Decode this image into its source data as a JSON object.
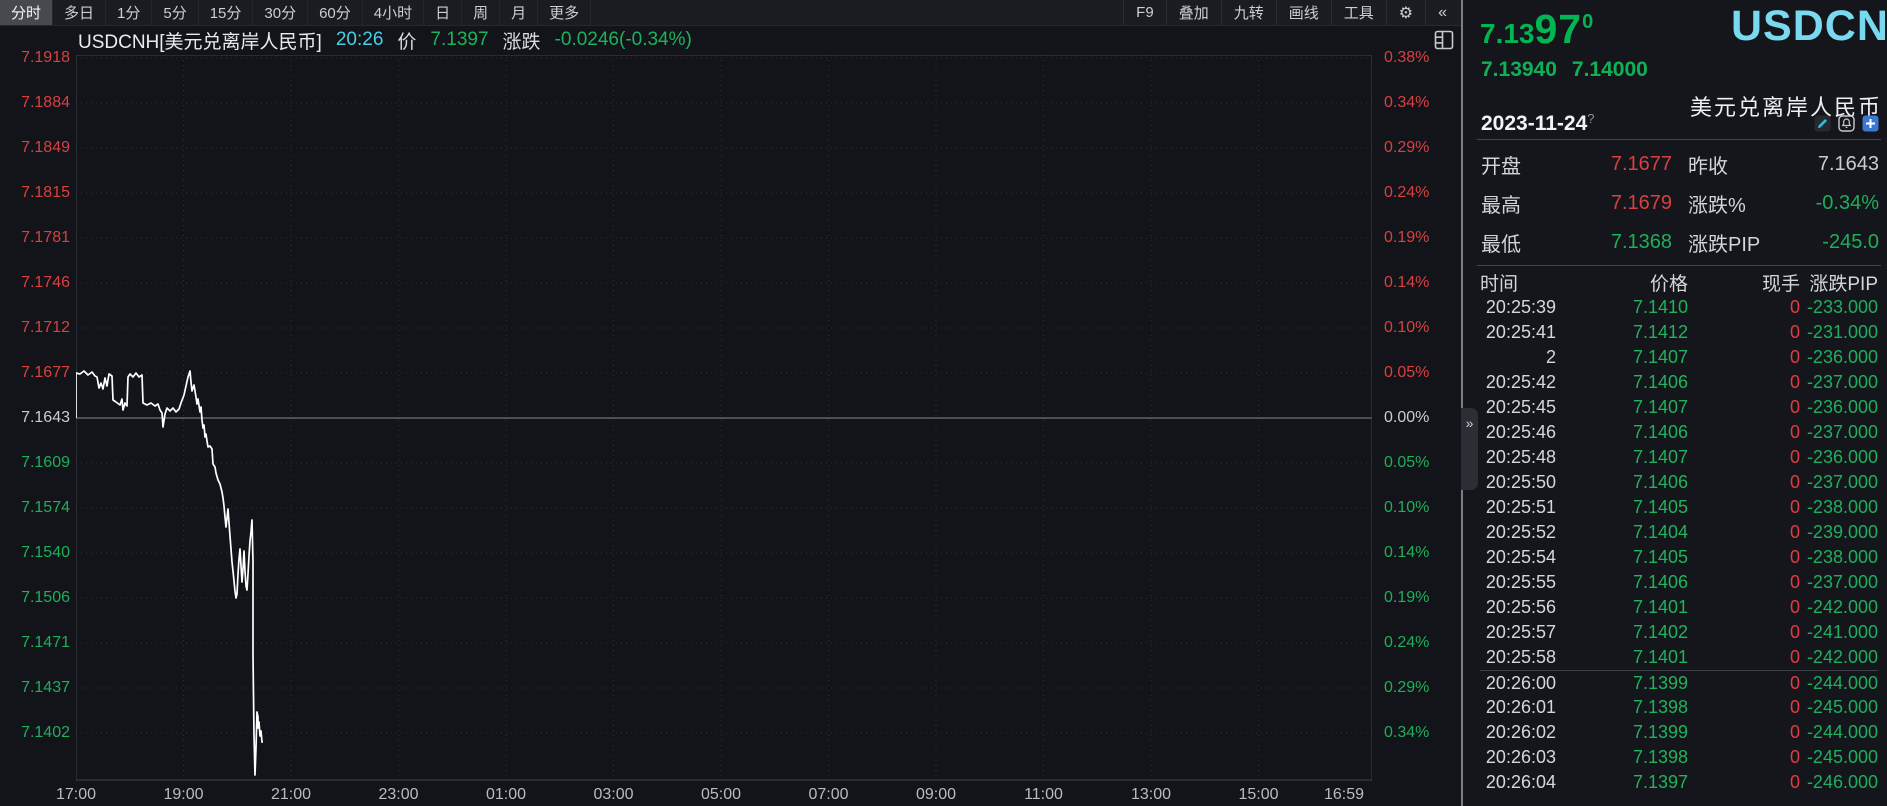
{
  "toolbar": {
    "tabs": [
      {
        "label": "分时",
        "selected": true
      },
      {
        "label": "多日",
        "selected": false
      },
      {
        "label": "1分",
        "selected": false
      },
      {
        "label": "5分",
        "selected": false
      },
      {
        "label": "15分",
        "selected": false
      },
      {
        "label": "30分",
        "selected": false
      },
      {
        "label": "60分",
        "selected": false
      },
      {
        "label": "4小时",
        "selected": false
      },
      {
        "label": "日",
        "selected": false
      },
      {
        "label": "周",
        "selected": false
      },
      {
        "label": "月",
        "selected": false
      },
      {
        "label": "更多",
        "selected": false
      }
    ],
    "right_buttons": [
      "F9",
      "叠加",
      "九转",
      "画线",
      "工具"
    ],
    "gear_icon": "⚙",
    "collapse_icon": "«"
  },
  "chart": {
    "title": {
      "symbol": "USDCNH[美元兑离岸人民币]",
      "time": "20:26",
      "price_label": "价",
      "price": "7.1397",
      "change_label": "涨跌",
      "change": "-0.0246(-0.34%)"
    },
    "left_axis": [
      {
        "t": "7.1918",
        "c": "r"
      },
      {
        "t": "7.1884",
        "c": "r"
      },
      {
        "t": "7.1849",
        "c": "r"
      },
      {
        "t": "7.1815",
        "c": "r"
      },
      {
        "t": "7.1781",
        "c": "r"
      },
      {
        "t": "7.1746",
        "c": "r"
      },
      {
        "t": "7.1712",
        "c": "r"
      },
      {
        "t": "7.1677",
        "c": "r"
      },
      {
        "t": "7.1643",
        "c": "w"
      },
      {
        "t": "7.1609",
        "c": "g"
      },
      {
        "t": "7.1574",
        "c": "g"
      },
      {
        "t": "7.1540",
        "c": "g"
      },
      {
        "t": "7.1506",
        "c": "g"
      },
      {
        "t": "7.1471",
        "c": "g"
      },
      {
        "t": "7.1437",
        "c": "g"
      },
      {
        "t": "7.1402",
        "c": "g"
      }
    ],
    "right_axis": [
      {
        "t": "0.38%",
        "c": "r"
      },
      {
        "t": "0.34%",
        "c": "r"
      },
      {
        "t": "0.29%",
        "c": "r"
      },
      {
        "t": "0.24%",
        "c": "r"
      },
      {
        "t": "0.19%",
        "c": "r"
      },
      {
        "t": "0.14%",
        "c": "r"
      },
      {
        "t": "0.10%",
        "c": "r"
      },
      {
        "t": "0.05%",
        "c": "r"
      },
      {
        "t": "0.00%",
        "c": "w"
      },
      {
        "t": "0.05%",
        "c": "g"
      },
      {
        "t": "0.10%",
        "c": "g"
      },
      {
        "t": "0.14%",
        "c": "g"
      },
      {
        "t": "0.19%",
        "c": "g"
      },
      {
        "t": "0.24%",
        "c": "g"
      },
      {
        "t": "0.29%",
        "c": "g"
      },
      {
        "t": "0.34%",
        "c": "g"
      }
    ],
    "x_axis": [
      "17:00",
      "19:00",
      "21:00",
      "23:00",
      "01:00",
      "03:00",
      "05:00",
      "07:00",
      "09:00",
      "11:00",
      "13:00",
      "15:00",
      "16:59"
    ],
    "line_points": [
      [
        76,
        418
      ],
      [
        76,
        373
      ],
      [
        80,
        374
      ],
      [
        84,
        371
      ],
      [
        88,
        375
      ],
      [
        92,
        372
      ],
      [
        95,
        376
      ],
      [
        97,
        377
      ],
      [
        99,
        388
      ],
      [
        101,
        383
      ],
      [
        103,
        389
      ],
      [
        105,
        378
      ],
      [
        107,
        386
      ],
      [
        109,
        374
      ],
      [
        112,
        376
      ],
      [
        113,
        400
      ],
      [
        116,
        402
      ],
      [
        120,
        405
      ],
      [
        122,
        399
      ],
      [
        123,
        410
      ],
      [
        125,
        403
      ],
      [
        127,
        406
      ],
      [
        128,
        377
      ],
      [
        130,
        374
      ],
      [
        133,
        377
      ],
      [
        136,
        373
      ],
      [
        139,
        377
      ],
      [
        142,
        375
      ],
      [
        143,
        403
      ],
      [
        147,
        405
      ],
      [
        151,
        403
      ],
      [
        155,
        406
      ],
      [
        158,
        404
      ],
      [
        160,
        410
      ],
      [
        162,
        413
      ],
      [
        163,
        427
      ],
      [
        165,
        414
      ],
      [
        167,
        408
      ],
      [
        170,
        411
      ],
      [
        173,
        408
      ],
      [
        176,
        412
      ],
      [
        179,
        409
      ],
      [
        181,
        403
      ],
      [
        184,
        395
      ],
      [
        186,
        386
      ],
      [
        188,
        377
      ],
      [
        190,
        371
      ],
      [
        191,
        382
      ],
      [
        192,
        391
      ],
      [
        194,
        385
      ],
      [
        196,
        397
      ],
      [
        197,
        404
      ],
      [
        198,
        399
      ],
      [
        200,
        412
      ],
      [
        201,
        407
      ],
      [
        202,
        420
      ],
      [
        203,
        428
      ],
      [
        204,
        425
      ],
      [
        205,
        437
      ],
      [
        206,
        434
      ],
      [
        207,
        441
      ],
      [
        208,
        447
      ],
      [
        210,
        446
      ],
      [
        212,
        449
      ],
      [
        213,
        464
      ],
      [
        215,
        467
      ],
      [
        216,
        473
      ],
      [
        218,
        480
      ],
      [
        220,
        484
      ],
      [
        222,
        492
      ],
      [
        223,
        498
      ],
      [
        224,
        506
      ],
      [
        225,
        517
      ],
      [
        226,
        527
      ],
      [
        227,
        518
      ],
      [
        228,
        509
      ],
      [
        229,
        523
      ],
      [
        230,
        536
      ],
      [
        231,
        549
      ],
      [
        232,
        562
      ],
      [
        233,
        571
      ],
      [
        234,
        581
      ],
      [
        235,
        591
      ],
      [
        236,
        598
      ],
      [
        237,
        594
      ],
      [
        238,
        574
      ],
      [
        239,
        559
      ],
      [
        240,
        549
      ],
      [
        241,
        566
      ],
      [
        242,
        582
      ],
      [
        243,
        569
      ],
      [
        244,
        551
      ],
      [
        245,
        571
      ],
      [
        246,
        586
      ],
      [
        247,
        590
      ],
      [
        248,
        574
      ],
      [
        249,
        556
      ],
      [
        250,
        541
      ],
      [
        251,
        532
      ],
      [
        252,
        520
      ],
      [
        253,
        562
      ],
      [
        253,
        655
      ],
      [
        254,
        735
      ],
      [
        255,
        775
      ],
      [
        256,
        748
      ],
      [
        257,
        712
      ],
      [
        258,
        717
      ],
      [
        258,
        728
      ],
      [
        259,
        722
      ],
      [
        260,
        736
      ],
      [
        261,
        731
      ],
      [
        262,
        742
      ],
      [
        263,
        742
      ]
    ]
  },
  "chart_data": {
    "type": "line",
    "title": "USDCNH 分时 (intraday time-share line)",
    "xlabel_ticks": [
      "17:00",
      "19:00",
      "21:00",
      "23:00",
      "01:00",
      "03:00",
      "05:00",
      "07:00",
      "09:00",
      "11:00",
      "13:00",
      "15:00",
      "16:59"
    ],
    "y_price_ticks": [
      7.1918,
      7.1884,
      7.1849,
      7.1815,
      7.1781,
      7.1746,
      7.1712,
      7.1677,
      7.1643,
      7.1609,
      7.1574,
      7.154,
      7.1506,
      7.1471,
      7.1437,
      7.1402
    ],
    "y_percent_ticks": [
      "0.38%",
      "0.34%",
      "0.29%",
      "0.24%",
      "0.19%",
      "0.14%",
      "0.10%",
      "0.05%",
      "0.00%",
      "-0.05%",
      "-0.10%",
      "-0.14%",
      "-0.19%",
      "-0.24%",
      "-0.29%",
      "-0.34%"
    ],
    "prev_close": 7.1643,
    "open": 7.1677,
    "high": 7.1679,
    "low": 7.1368,
    "last": 7.1397,
    "series_summary": "Opens ~7.1677 at 17:00, oscillates between 7.1643 and 7.1677 until ~19:50, steps down through 7.1600/7.1540 to ~7.1506 by ~20:15, rebounds to ~7.1567, plunges vertically to low 7.1368 ~20:25, ends at 7.1397 at 20:26"
  },
  "panel": {
    "last_price_main": "7.13",
    "last_price_big": "97",
    "last_price_sup": "0",
    "bid": "7.13940",
    "ask": "7.14000",
    "symbol": "USDCNH",
    "name_cn": "美元兑离岸人民币",
    "date": "2023-11-24",
    "date_sup": "?",
    "expand_icon": "»",
    "info_rows": [
      {
        "l1": "开盘",
        "v1": "7.1677",
        "c1": "r",
        "l2": "昨收",
        "v2": "7.1643",
        "c2": "w"
      },
      {
        "l1": "最高",
        "v1": "7.1679",
        "c1": "r",
        "l2": "涨跌%",
        "v2": "-0.34%",
        "c2": "g"
      },
      {
        "l1": "最低",
        "v1": "7.1368",
        "c1": "g",
        "l2": "涨跌PIP",
        "v2": "-245.0",
        "c2": "g"
      }
    ],
    "table": {
      "headers": [
        "时间",
        "价格",
        "现手",
        "涨跌PIP"
      ],
      "minute_break_index": 15,
      "rows": [
        [
          "20:25:39",
          "7.1410",
          "0",
          "-233.000"
        ],
        [
          "20:25:41",
          "7.1412",
          "0",
          "-231.000"
        ],
        [
          "2",
          "7.1407",
          "0",
          "-236.000"
        ],
        [
          "20:25:42",
          "7.1406",
          "0",
          "-237.000"
        ],
        [
          "20:25:45",
          "7.1407",
          "0",
          "-236.000"
        ],
        [
          "20:25:46",
          "7.1406",
          "0",
          "-237.000"
        ],
        [
          "20:25:48",
          "7.1407",
          "0",
          "-236.000"
        ],
        [
          "20:25:50",
          "7.1406",
          "0",
          "-237.000"
        ],
        [
          "20:25:51",
          "7.1405",
          "0",
          "-238.000"
        ],
        [
          "20:25:52",
          "7.1404",
          "0",
          "-239.000"
        ],
        [
          "20:25:54",
          "7.1405",
          "0",
          "-238.000"
        ],
        [
          "20:25:55",
          "7.1406",
          "0",
          "-237.000"
        ],
        [
          "20:25:56",
          "7.1401",
          "0",
          "-242.000"
        ],
        [
          "20:25:57",
          "7.1402",
          "0",
          "-241.000"
        ],
        [
          "20:25:58",
          "7.1401",
          "0",
          "-242.000"
        ],
        [
          "20:26:00",
          "7.1399",
          "0",
          "-244.000"
        ],
        [
          "20:26:01",
          "7.1398",
          "0",
          "-245.000"
        ],
        [
          "20:26:02",
          "7.1399",
          "0",
          "-244.000"
        ],
        [
          "20:26:03",
          "7.1398",
          "0",
          "-245.000"
        ],
        [
          "20:26:04",
          "7.1397",
          "0",
          "-246.000"
        ]
      ]
    }
  },
  "colors": {
    "up_red": "#d94040",
    "down_green": "#1fae5a",
    "flat_white": "#c9ccd1",
    "accent_cyan": "#47cfe8",
    "symbol_cyan": "#79d9ef",
    "big_price_green": "#00b653",
    "volume_red": "#e23b40",
    "background": "#121419",
    "line_white": "#ffffff"
  }
}
